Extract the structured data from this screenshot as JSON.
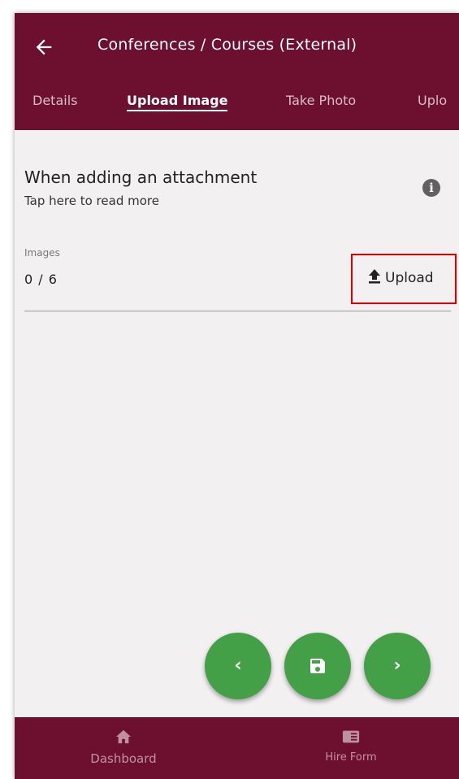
{
  "header": {
    "title": "Conferences / Courses (External)"
  },
  "tabs": [
    {
      "label": "Details"
    },
    {
      "label": "Upload Image"
    },
    {
      "label": "Take Photo"
    },
    {
      "label": "Uplo"
    }
  ],
  "info": {
    "title": "When adding an attachment",
    "subtitle": "Tap here to read more",
    "icon": "i"
  },
  "images": {
    "label": "Images",
    "count": "0 / 6",
    "upload_label": "Upload"
  },
  "fabs": {
    "prev": "‹",
    "next": "›"
  },
  "bottom_nav": [
    {
      "label": "Dashboard",
      "icon": "home-icon"
    },
    {
      "label": "Hire Form",
      "icon": "form-icon"
    }
  ],
  "colors": {
    "brand": "#6d0f2e",
    "fab": "#43a047",
    "highlight": "#e00000",
    "background": "#f2f0f1"
  }
}
